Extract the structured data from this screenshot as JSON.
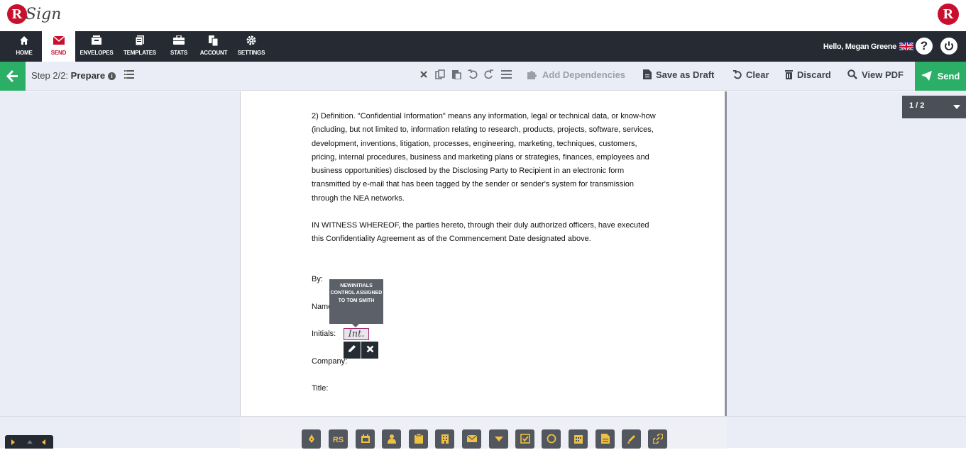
{
  "app": {
    "logo_letter": "R",
    "logo_word": "Sign",
    "brand_letter": "R",
    "greeting": "Hello, Megan Greene",
    "help_label": "?"
  },
  "nav": [
    {
      "label": "HOME",
      "icon": "home-icon"
    },
    {
      "label": "SEND",
      "icon": "envelope-icon"
    },
    {
      "label": "ENVELOPES",
      "icon": "inbox-icon"
    },
    {
      "label": "TEMPLATES",
      "icon": "document-stack-icon"
    },
    {
      "label": "STATS",
      "icon": "briefcase-icon"
    },
    {
      "label": "ACCOUNT",
      "icon": "copy-icon"
    },
    {
      "label": "SETTINGS",
      "icon": "gear-icon"
    }
  ],
  "toolbar": {
    "step_prefix": "Step 2/2:",
    "step_name": "Prepare",
    "add_dependencies": "Add Dependencies",
    "save_as_draft": "Save as Draft",
    "clear": "Clear",
    "discard": "Discard",
    "view_pdf": "View PDF",
    "send": "Send"
  },
  "pager": {
    "label": "1 / 2"
  },
  "document": {
    "definition": "2) Definition.  \"Confidential Information\" means any information, legal or technical data, or know-how (including, but not limited to, information relating to research, products, projects, software, services, development, inventions, litigation, processes, engineering, marketing, techniques, customers, pricing, internal procedures, business and marketing plans or strategies, finances, employees and business opportunities) disclosed by the Disclosing Party to Recipient in an electronic form transmitted by e-mail that has been tagged by the sender or sender's system for transmission through the NEA networks.",
    "witness": "IN WITNESS WHEREOF, the parties hereto, through their duly authorized officers, have executed this Confidentiality Agreement as of the Commencement Date designated above.",
    "by_label": "By:",
    "name_label": "Name:",
    "initials_label": "Initials:",
    "initials_placeholder": "Int.",
    "company_label": "Company:",
    "title_label": "Title:"
  },
  "tooltip": {
    "text": "NEWINITIALS CONTROL ASSIGNED TO TOM SMITH"
  },
  "controls": [
    {
      "label": "",
      "icon": "signature-pen-icon"
    },
    {
      "label": "RS",
      "icon": "initials-icon"
    },
    {
      "label": "",
      "icon": "date-stamp-icon"
    },
    {
      "label": "",
      "icon": "person-icon"
    },
    {
      "label": "",
      "icon": "clipboard-icon"
    },
    {
      "label": "",
      "icon": "building-icon"
    },
    {
      "label": "",
      "icon": "email-icon"
    },
    {
      "label": "",
      "icon": "dropdown-icon"
    },
    {
      "label": "",
      "icon": "checkbox-icon"
    },
    {
      "label": "",
      "icon": "radio-icon"
    },
    {
      "label": "",
      "icon": "calendar-icon"
    },
    {
      "label": "",
      "icon": "text-field-icon"
    },
    {
      "label": "",
      "icon": "label-pen-icon"
    },
    {
      "label": "",
      "icon": "hyperlink-icon"
    }
  ],
  "colors": {
    "brand_red": "#c8102e",
    "nav_dark": "#252a33",
    "send_green": "#2bae66",
    "control_gold": "#f0c040"
  }
}
